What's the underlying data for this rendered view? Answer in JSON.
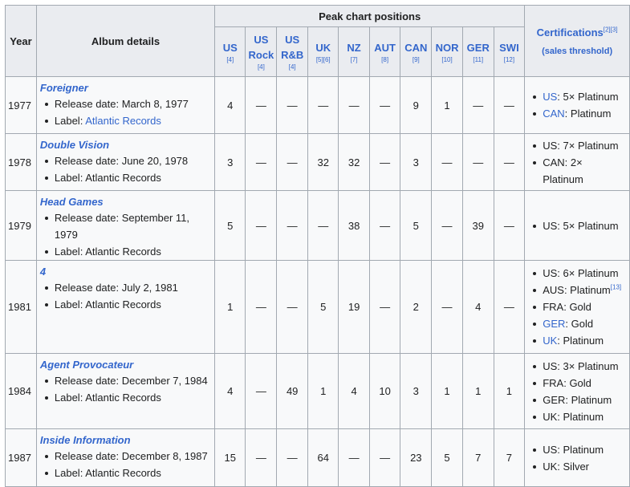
{
  "header": {
    "year": "Year",
    "album_details": "Album details",
    "peak": "Peak chart positions",
    "certifications": "Certifications",
    "cert_refs": "[2][3]",
    "sales_threshold": "(sales threshold)",
    "columns": [
      {
        "label": "US",
        "ref": "[4]"
      },
      {
        "label": "US Rock",
        "ref": "[4]"
      },
      {
        "label": "US R&B",
        "ref": "[4]"
      },
      {
        "label": "UK",
        "ref": "[5][6]"
      },
      {
        "label": "NZ",
        "ref": "[7]"
      },
      {
        "label": "AUT",
        "ref": "[8]"
      },
      {
        "label": "CAN",
        "ref": "[9]"
      },
      {
        "label": "NOR",
        "ref": "[10]"
      },
      {
        "label": "GER",
        "ref": "[11]"
      },
      {
        "label": "SWI",
        "ref": "[12]"
      }
    ]
  },
  "rows": [
    {
      "year": "1977",
      "title": "Foreigner",
      "release": "Release date: March 8, 1977",
      "label_prefix": "Label: ",
      "label": "Atlantic Records",
      "peaks": [
        "4",
        "—",
        "—",
        "—",
        "—",
        "—",
        "9",
        "1",
        "—",
        "—"
      ],
      "certs": [
        {
          "country": "US",
          "text": ": 5× Platinum"
        },
        {
          "country": "CAN",
          "text": ": Platinum"
        }
      ]
    },
    {
      "year": "1978",
      "title": "Double Vision",
      "release": "Release date: June 20, 1978",
      "label_prefix": "Label: ",
      "label": "Atlantic Records",
      "peaks": [
        "3",
        "—",
        "—",
        "32",
        "32",
        "—",
        "3",
        "—",
        "—",
        "—"
      ],
      "certs": [
        {
          "country": "US",
          "text": ": 7× Platinum"
        },
        {
          "country": "CAN",
          "text": ": 2× Platinum"
        }
      ]
    },
    {
      "year": "1979",
      "title": "Head Games",
      "release": "Release date: September 11, 1979",
      "label_prefix": "Label: ",
      "label": "Atlantic Records",
      "peaks": [
        "5",
        "—",
        "—",
        "—",
        "38",
        "—",
        "5",
        "—",
        "39",
        "—"
      ],
      "certs": [
        {
          "country": "US",
          "text": ": 5× Platinum"
        }
      ]
    },
    {
      "year": "1981",
      "title": "4",
      "release": "Release date: July 2, 1981",
      "label_prefix": "Label: ",
      "label": "Atlantic Records",
      "peaks": [
        "1",
        "—",
        "—",
        "5",
        "19",
        "—",
        "2",
        "—",
        "4",
        "—"
      ],
      "certs": [
        {
          "country": "US",
          "text": ": 6× Platinum"
        },
        {
          "country": "AUS",
          "text": ": Platinum",
          "ref": "[13]"
        },
        {
          "country": "FRA",
          "text": ": Gold"
        },
        {
          "country": "GER",
          "text": ": Gold"
        },
        {
          "country": "UK",
          "text": ": Platinum"
        }
      ]
    },
    {
      "year": "1984",
      "title": "Agent Provocateur",
      "release": "Release date: December 7, 1984",
      "label_prefix": "Label: ",
      "label": "Atlantic Records",
      "peaks": [
        "4",
        "—",
        "49",
        "1",
        "4",
        "10",
        "3",
        "1",
        "1",
        "1"
      ],
      "certs": [
        {
          "country": "US",
          "text": ": 3× Platinum"
        },
        {
          "country": "FRA",
          "text": ": Gold"
        },
        {
          "country": "GER",
          "text": ": Platinum"
        },
        {
          "country": "UK",
          "text": ": Platinum"
        }
      ]
    },
    {
      "year": "1987",
      "title": "Inside Information",
      "release": "Release date: December 8, 1987",
      "label_prefix": "Label: ",
      "label": "Atlantic Records",
      "peaks": [
        "15",
        "—",
        "—",
        "64",
        "—",
        "—",
        "23",
        "5",
        "7",
        "7"
      ],
      "certs": [
        {
          "country": "US",
          "text": ": Platinum"
        },
        {
          "country": "UK",
          "text": ": Silver"
        }
      ]
    }
  ]
}
